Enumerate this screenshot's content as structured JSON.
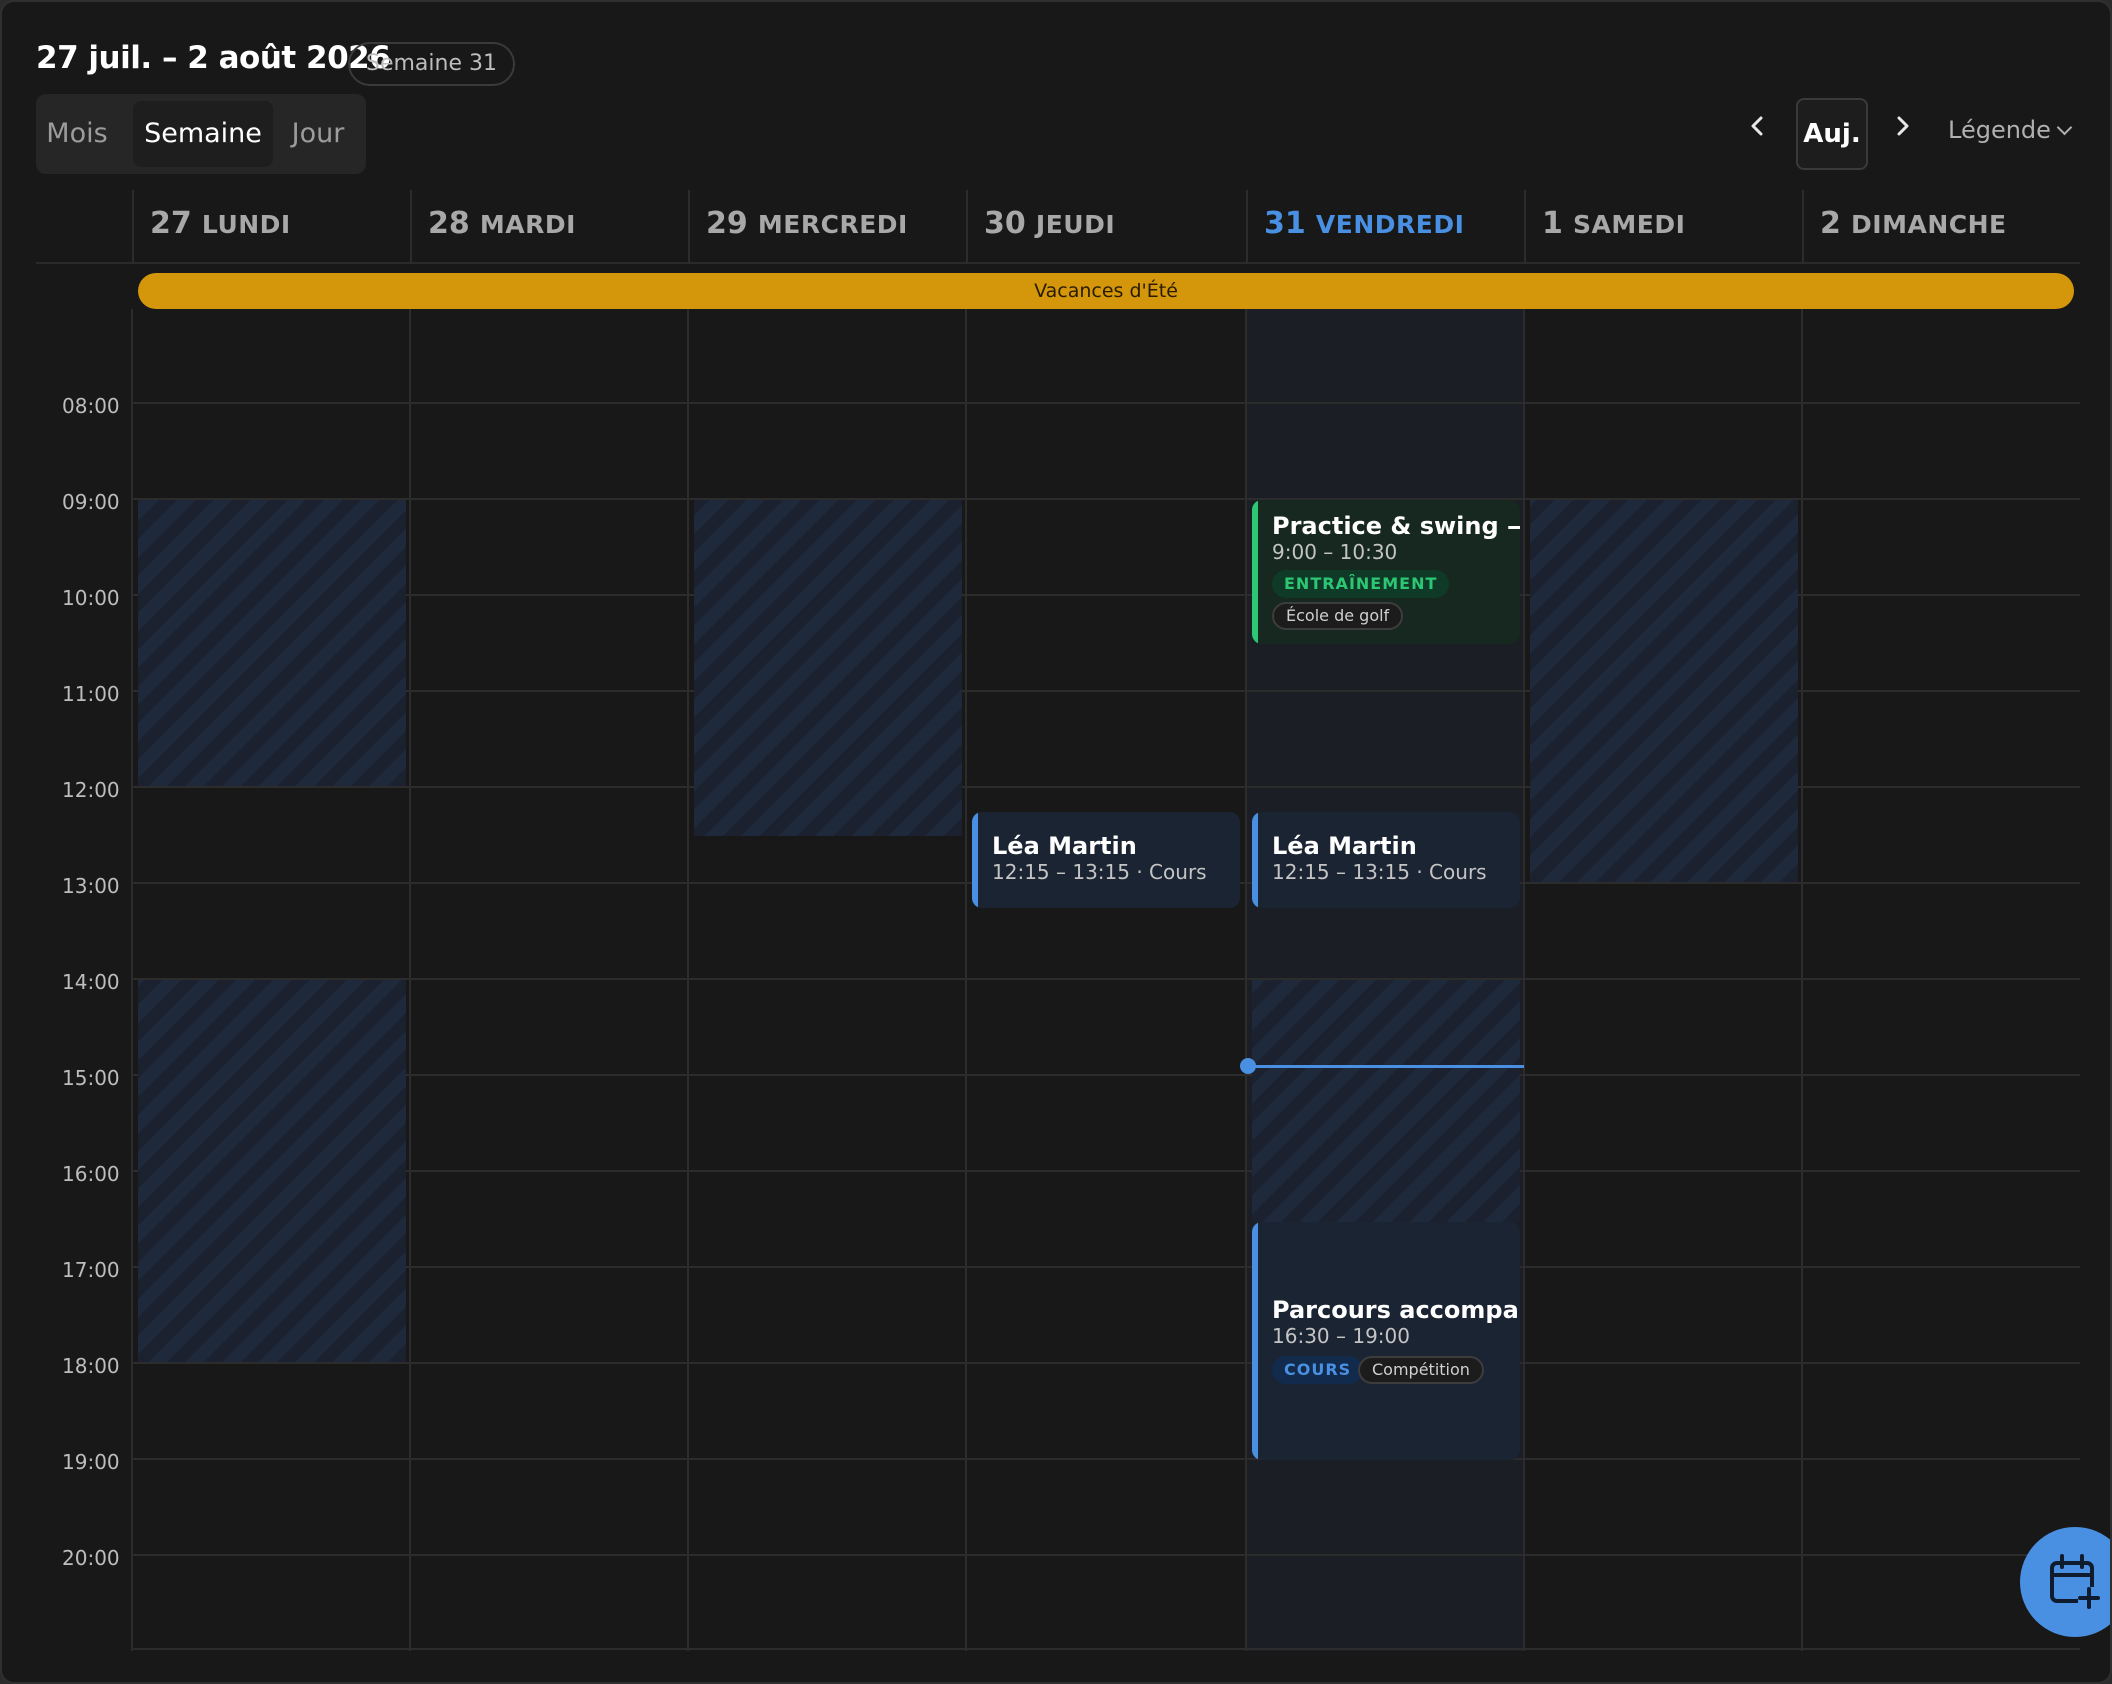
{
  "header": {
    "title": "27 juil. – 2 août 2026",
    "week_badge": "Semaine 31",
    "views": [
      "Mois",
      "Semaine",
      "Jour"
    ],
    "active_view": "Semaine",
    "today_label": "Auj.",
    "legend_label": "Légende"
  },
  "days": [
    {
      "num": "27",
      "name": "LUNDI"
    },
    {
      "num": "28",
      "name": "MARDI"
    },
    {
      "num": "29",
      "name": "MERCREDI"
    },
    {
      "num": "30",
      "name": "JEUDI"
    },
    {
      "num": "31",
      "name": "VENDREDI",
      "today": true
    },
    {
      "num": "1",
      "name": "SAMEDI"
    },
    {
      "num": "2",
      "name": "DIMANCHE"
    }
  ],
  "all_day": {
    "label": "Vacances d'Été",
    "color": "#d4960a"
  },
  "hours": [
    "08:00",
    "09:00",
    "10:00",
    "11:00",
    "12:00",
    "13:00",
    "14:00",
    "15:00",
    "16:00",
    "17:00",
    "18:00",
    "19:00",
    "20:00"
  ],
  "events": [
    {
      "title": "Practice & swing — ...",
      "time": "9:00 – 10:30",
      "tag": "ENTRAÎNEMENT",
      "chip": "École de golf",
      "color": "#2dc774"
    },
    {
      "title": "Léa Martin",
      "time": "12:15 – 13:15 · Cours",
      "color": "#4a90e2"
    },
    {
      "title": "Léa Martin",
      "time": "12:15 – 13:15 · Cours",
      "color": "#4a90e2"
    },
    {
      "title": "Parcours accompa...",
      "time": "16:30 – 19:00",
      "tag": "COURS",
      "chip": "Compétition",
      "color": "#4a90e2"
    }
  ],
  "colors": {
    "accent": "#4a90e2",
    "training": "#2dc774",
    "holiday": "#d4960a",
    "background": "#181818"
  },
  "icons": [
    "chevron-left-icon",
    "chevron-right-icon",
    "chevron-down-icon",
    "calendar-plus-icon"
  ]
}
